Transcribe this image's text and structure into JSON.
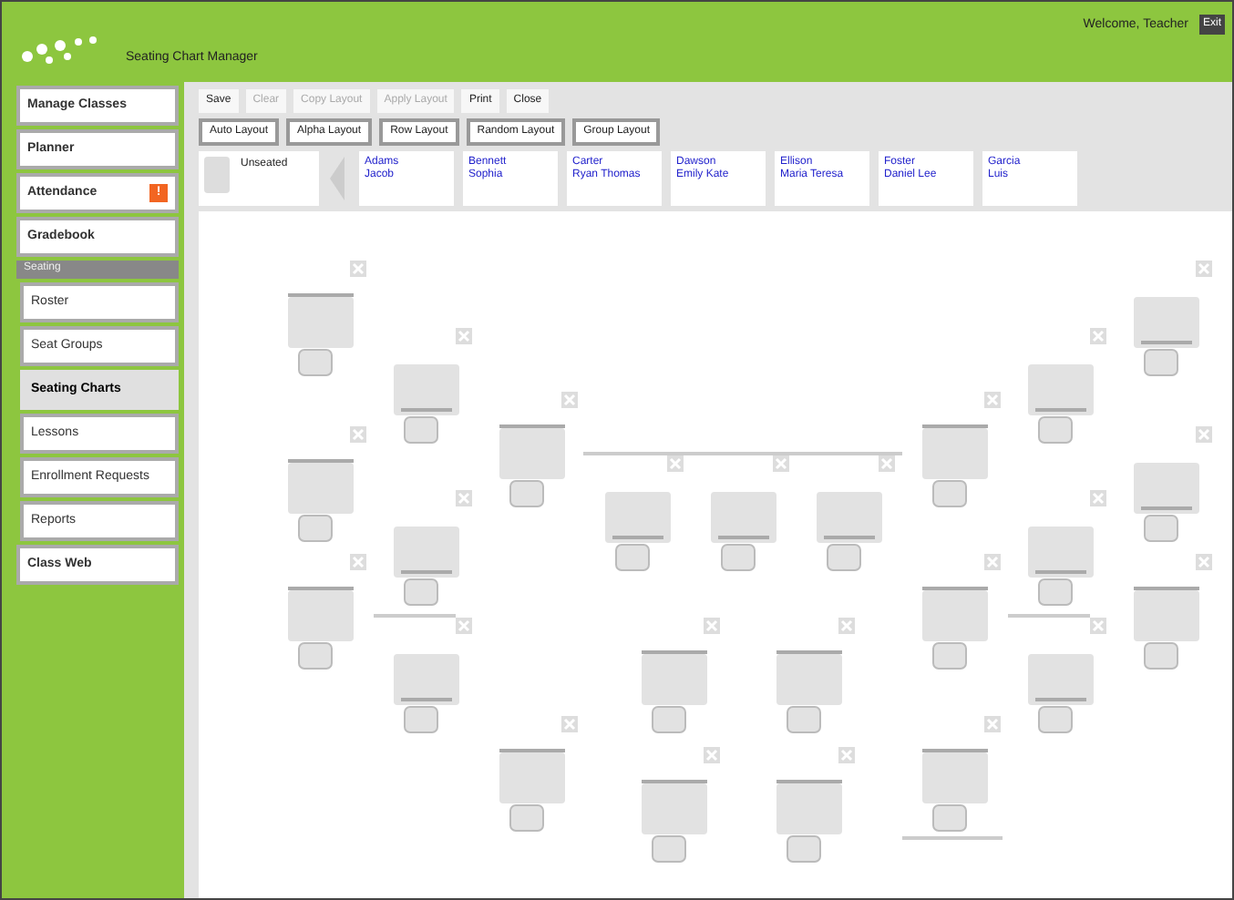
{
  "header": {
    "app_title": "Seating Chart Manager",
    "user": "Welcome, Teacher",
    "logout": "Exit"
  },
  "sidebar": {
    "items": [
      {
        "label": "Manage Classes",
        "kind": "item",
        "selected": false
      },
      {
        "label": "Planner",
        "kind": "item",
        "selected": false
      },
      {
        "label": "Attendance",
        "kind": "item",
        "selected": false,
        "badge": "!"
      },
      {
        "label": "Gradebook",
        "kind": "item",
        "selected": false
      },
      {
        "label": "Seating",
        "kind": "header"
      },
      {
        "label": "Roster",
        "kind": "sub",
        "selected": false
      },
      {
        "label": "Seat Groups",
        "kind": "sub",
        "selected": false
      },
      {
        "label": "Seating Charts",
        "kind": "sub",
        "selected": true
      },
      {
        "label": "Lessons",
        "kind": "sub",
        "selected": false
      },
      {
        "label": "Enrollment Requests",
        "kind": "sub",
        "selected": false
      },
      {
        "label": "Reports",
        "kind": "sub",
        "selected": false
      },
      {
        "label": "Class Web",
        "kind": "item",
        "selected": false
      }
    ]
  },
  "toolbar": {
    "buttons": [
      {
        "label": "Save",
        "disabled": false
      },
      {
        "label": "Clear",
        "disabled": true
      },
      {
        "label": "Copy Layout",
        "disabled": true
      },
      {
        "label": "Apply Layout",
        "disabled": true
      },
      {
        "label": "Print",
        "disabled": false
      },
      {
        "label": "Close",
        "disabled": false
      }
    ],
    "layouts": [
      "Auto Layout",
      "Alpha Layout",
      "Row Layout",
      "Random Layout",
      "Group Layout"
    ]
  },
  "students": {
    "unseated_label": "Unseated",
    "cards": [
      {
        "last": "Adams",
        "first": "Jacob"
      },
      {
        "last": "Bennett",
        "first": "Sophia"
      },
      {
        "last": "Carter",
        "first": "Ryan Thomas"
      },
      {
        "last": "Dawson",
        "first": "Emily Kate"
      },
      {
        "last": "Ellison",
        "first": "Maria Teresa"
      },
      {
        "last": "Foster",
        "first": "Daniel Lee"
      },
      {
        "last": "Garcia",
        "first": "Luis"
      }
    ]
  }
}
